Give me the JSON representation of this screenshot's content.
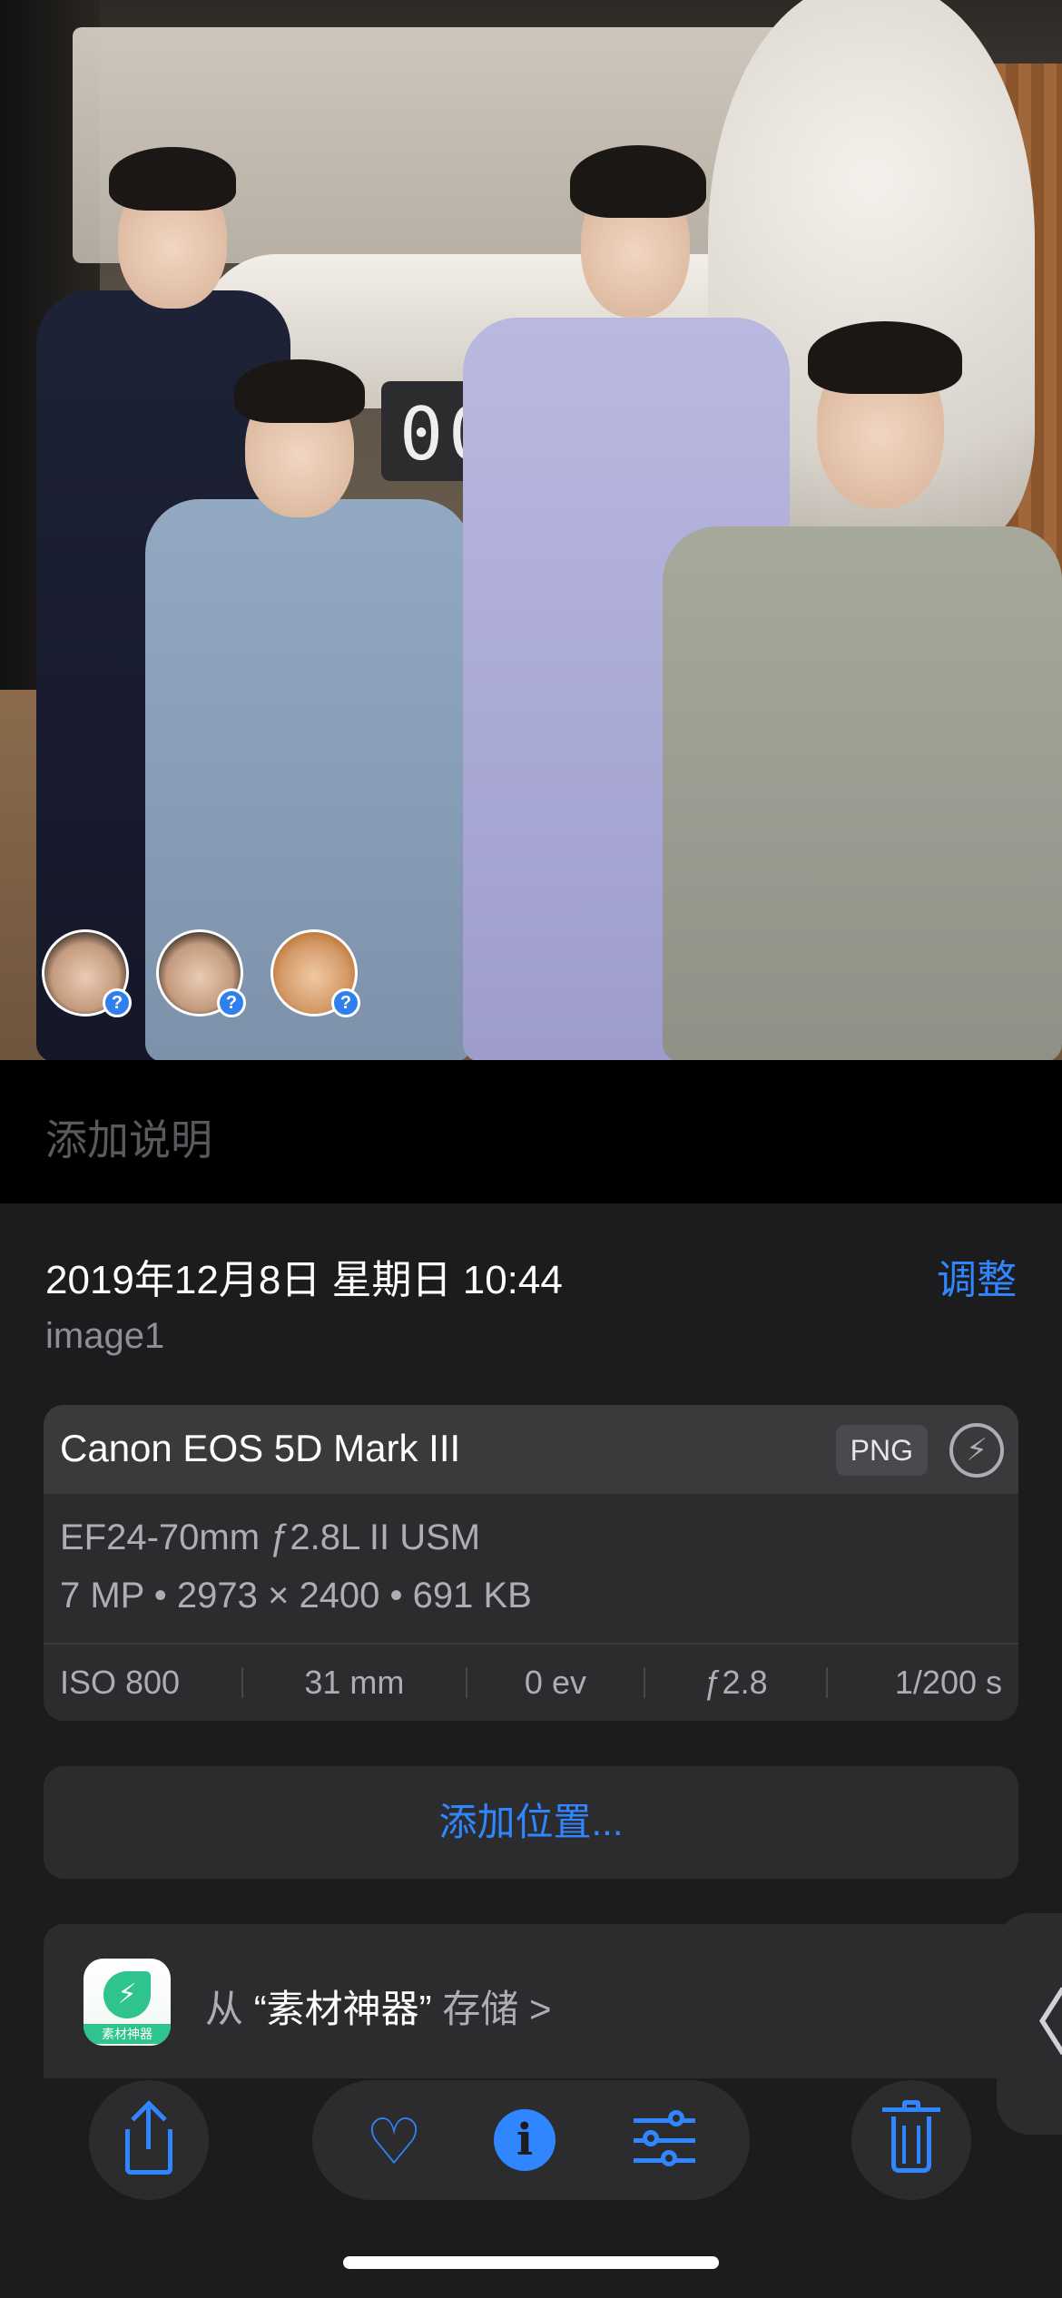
{
  "photo": {
    "sign_text": "00",
    "faces": [
      {
        "badge": "?"
      },
      {
        "badge": "?"
      },
      {
        "badge": "?"
      }
    ]
  },
  "caption": {
    "placeholder": "添加说明"
  },
  "info": {
    "date_time": "2019年12月8日 星期日 10:44",
    "adjust_label": "调整",
    "filename": "image1"
  },
  "camera_card": {
    "camera": "Canon EOS 5D Mark III",
    "format_badge": "PNG",
    "lens": "EF24-70mm ƒ2.8L II USM",
    "specs": "7 MP • 2973 × 2400 • 691 KB",
    "exif": {
      "iso": "ISO 800",
      "focal": "31 mm",
      "ev": "0 ev",
      "aperture": "ƒ2.8",
      "shutter": "1/200 s"
    }
  },
  "location": {
    "label": "添加位置..."
  },
  "app_row": {
    "icon_label": "素材神器",
    "prefix": "从",
    "app_name": "“素材神器”",
    "suffix": "存储",
    "chevron": ">"
  },
  "side_tab": {
    "glyph": "〈"
  },
  "toolbar": {
    "info_glyph": "i",
    "heart_glyph": "♡"
  },
  "colors": {
    "accent": "#2f86ff",
    "panel": "#1c1c1e",
    "card": "#2c2c2e"
  },
  "icons": [
    "share-icon",
    "heart-icon",
    "info-icon",
    "sliders-icon",
    "trash-icon",
    "flash-icon",
    "chevron-left-icon",
    "chevron-right-icon"
  ]
}
